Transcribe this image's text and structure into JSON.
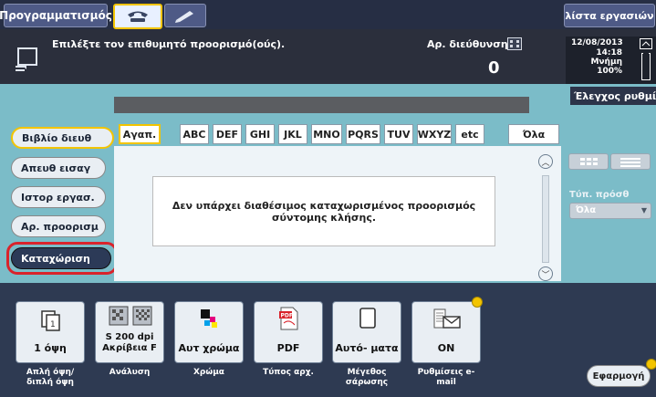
{
  "top_tabs": {
    "programming": "Προγραμματισμός",
    "job_list": "λίστα εργασιών"
  },
  "header": {
    "instruction": "Επιλέξτε τον επιθυμητό προορισμό(ούς).",
    "addr_label": "Αρ. διεύθυνση",
    "count": "0",
    "date": "12/08/2013",
    "time": "14:18",
    "memory_label": "Μνήμη",
    "memory_value": "100%",
    "check_settings": "Έλεγχος ρυθμίσεων"
  },
  "side_buttons": {
    "address_book": "Βιβλίο διευθ",
    "direct_input": "Απευθ εισαγ",
    "job_history": "Ιστορ εργασ.",
    "search_dest": "Αρ. προορισμ",
    "register": "Καταχώριση"
  },
  "index_tabs": [
    "Αγαπ.",
    "ABC",
    "DEF",
    "GHI",
    "JKL",
    "MNO",
    "PQRS",
    "TUV",
    "WXYZ",
    "etc",
    "Όλα"
  ],
  "message": "Δεν υπάρχει διαθέσιμος καταχωρισμένος προορισμός σύντομης κλήσης.",
  "filter": {
    "label": "Τύπ. πρόσθ",
    "value": "Όλα"
  },
  "functions": [
    {
      "value": "1 όψη",
      "label": "Απλή όψη/ διπλή όψη",
      "icon": "duplex-icon"
    },
    {
      "value": "S 200 dpi Ακρίβεια F",
      "label": "Ανάλυση",
      "icon": "resolution-icon"
    },
    {
      "value": "Αυτ χρώμα",
      "label": "Χρώμα",
      "icon": "color-icon"
    },
    {
      "value": "PDF",
      "label": "Τύπος αρχ.",
      "icon": "pdf-icon"
    },
    {
      "value": "Αυτό- ματα",
      "label": "Μέγεθος σάρωσης",
      "icon": "page-size-icon"
    },
    {
      "value": "ON",
      "label": "Ρυθμίσεις e-mail",
      "icon": "email-settings-icon"
    }
  ],
  "apply_button": "Εφαρμογή",
  "colors": {
    "highlight_border": "#d9232b",
    "accent_yellow": "#f3c400",
    "background_teal": "#7bbcc8",
    "dark_bar": "#262e44"
  }
}
